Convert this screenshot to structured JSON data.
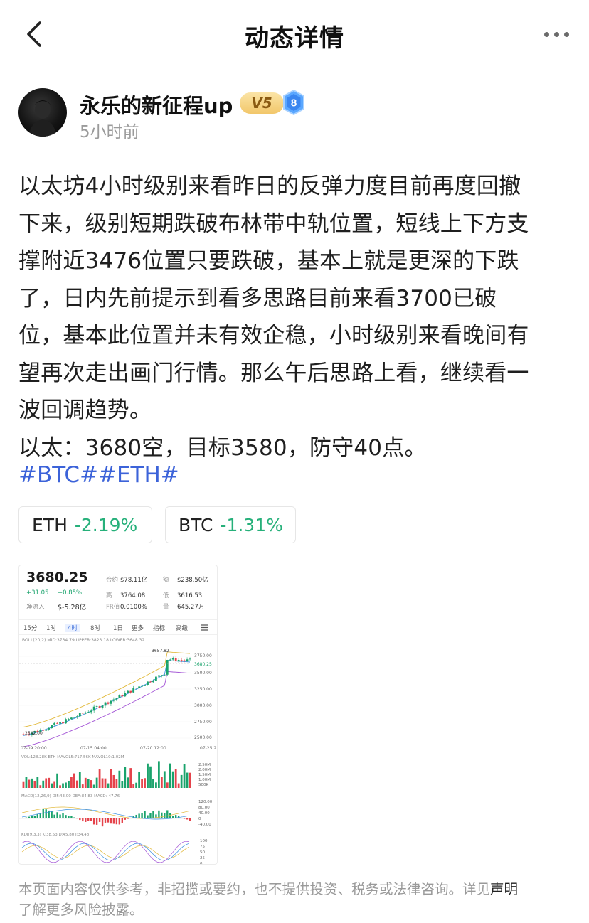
{
  "header": {
    "title": "动态详情"
  },
  "author": {
    "name": "永乐的新征程up",
    "vip_badge": "V5",
    "level_badge": "8",
    "time": "5小时前"
  },
  "post": {
    "lines": [
      "以太坊4小时级别来看昨日的反弹力度目前再度回撤",
      "下来，级别短期跌破布林带中轨位置，短线上下方支",
      "撑附近3476位置只要跌破，基本上就是更深的下跌",
      "了，日内先前提示到看多思路目前来看3700已破",
      "位，基本此位置并未有效企稳，小时级别来看晚间有",
      "望再次走出画门行情。那么午后思路上看，继续看一",
      "波回调趋势。",
      "以太：3680空，目标3580，防守40点。"
    ],
    "tags": "#BTC##ETH#"
  },
  "tickers": [
    {
      "symbol": "ETH",
      "change": "-2.19%"
    },
    {
      "symbol": "BTC",
      "change": "-1.31%"
    }
  ],
  "chart_card": {
    "price": "3680.25",
    "change_abs": "+31.05",
    "change_pct": "+0.85%",
    "net_inflow_label": "净流入",
    "net_inflow": "$-5.28亿",
    "stats": [
      {
        "k": "合约",
        "v": "$78.11亿"
      },
      {
        "k": "额",
        "v": "$238.50亿"
      },
      {
        "k": "高",
        "v": "3764.08"
      },
      {
        "k": "低",
        "v": "3616.53"
      },
      {
        "k": "FR值",
        "v": "0.0100%"
      },
      {
        "k": "量",
        "v": "645.27万"
      }
    ],
    "tabs": [
      "15分",
      "1时",
      "4时",
      "8时",
      "1日",
      "更多",
      "指标",
      "高级"
    ],
    "active_tab": "4时",
    "boll_legend": "BOLL(20,2) MID:3734.79 UPPER:3823.18 LOWER:3648.32",
    "y_ticks": [
      "3750.00",
      "3500.00",
      "3250.00",
      "3000.00",
      "2750.00",
      "2500.00"
    ],
    "x_ticks": [
      "07-09 20:00",
      "07-15 04:00",
      "07-20 12:00",
      "07-25 2"
    ],
    "high_mark": "3657.82",
    "low_mark": "2542.00",
    "current_mark": "3680.25",
    "vol_legend": "VOL:128.28K ETH MAVOL5:717.56K MAVOL10:1.02M",
    "vol_ticks": [
      "2.50M",
      "2.00M",
      "1.50M",
      "1.00M",
      "500K"
    ],
    "vol_current": "128.28K",
    "macd_legend": "MACD(12,26,9) DIF:43.00 DEA:84.83 MACD:-47.76",
    "macd_ticks": [
      "120.00",
      "80.00",
      "40.00",
      "0",
      "-40.00"
    ],
    "kdj_legend": "KDJ(9,3,3) K:38.53 D:45.80 J:34.48",
    "kdj_ticks": [
      "100",
      "75",
      "50",
      "25",
      "0"
    ],
    "colors": {
      "up": "#1aa36c",
      "down": "#e5434b",
      "mid": "#3a8fe0",
      "upper": "#e2b93b",
      "lower": "#a354d6"
    }
  },
  "disclaimer": {
    "text": "本页面内容仅供参考，非招揽或要约，也不提供投资、税务或法律咨询。详见",
    "link": "声明",
    "text2": "了解更多风险披露。"
  }
}
